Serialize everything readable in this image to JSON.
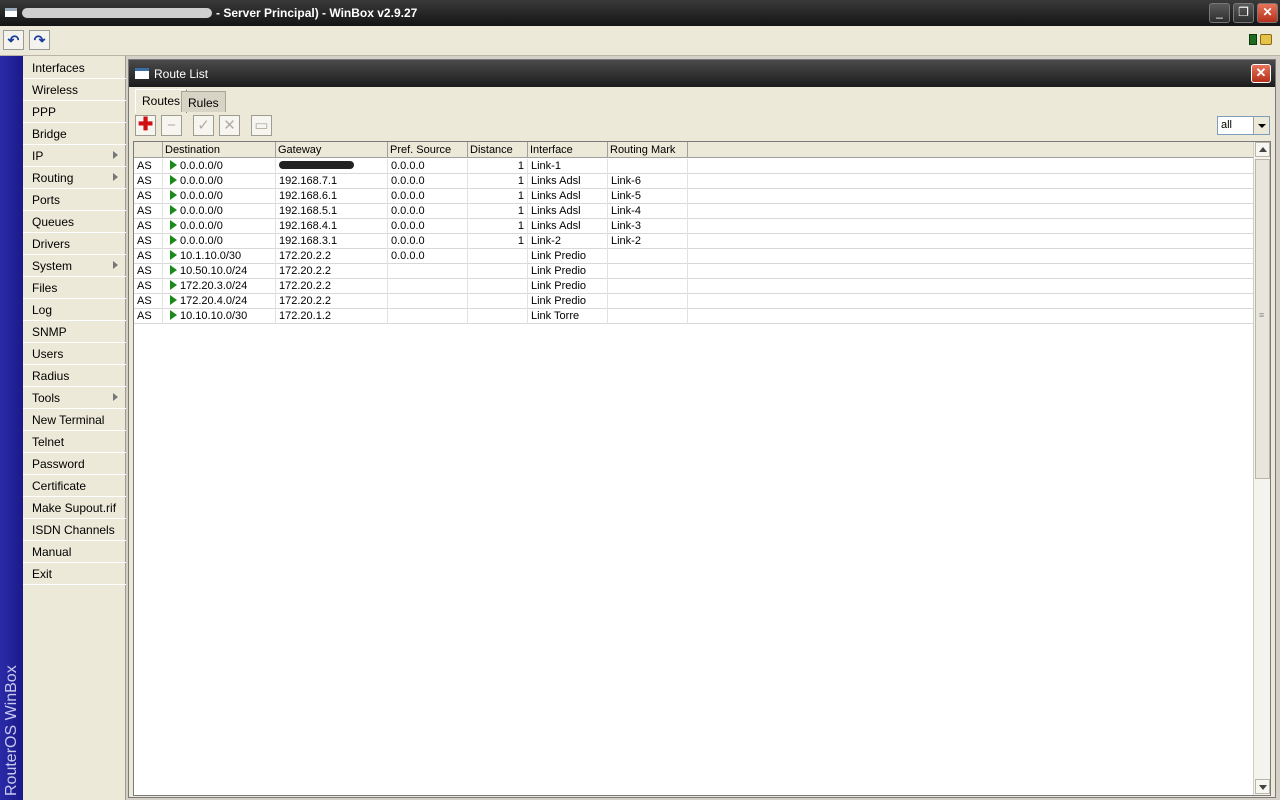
{
  "window": {
    "title": "- Server Principal) - WinBox v2.9.27",
    "minimize": "_",
    "restore": "❐",
    "close": "✕"
  },
  "toolbar": {
    "undo": "↶",
    "redo": "↷"
  },
  "brand": "RouterOS WinBox",
  "menu": [
    {
      "label": "Interfaces"
    },
    {
      "label": "Wireless"
    },
    {
      "label": "PPP"
    },
    {
      "label": "Bridge"
    },
    {
      "label": "IP",
      "submenu": true
    },
    {
      "label": "Routing",
      "submenu": true
    },
    {
      "label": "Ports"
    },
    {
      "label": "Queues"
    },
    {
      "label": "Drivers"
    },
    {
      "label": "System",
      "submenu": true
    },
    {
      "label": "Files"
    },
    {
      "label": "Log"
    },
    {
      "label": "SNMP"
    },
    {
      "label": "Users"
    },
    {
      "label": "Radius"
    },
    {
      "label": "Tools",
      "submenu": true
    },
    {
      "label": "New Terminal"
    },
    {
      "label": "Telnet"
    },
    {
      "label": "Password"
    },
    {
      "label": "Certificate"
    },
    {
      "label": "Make Supout.rif"
    },
    {
      "label": "ISDN Channels"
    },
    {
      "label": "Manual"
    },
    {
      "label": "Exit"
    }
  ],
  "route_window": {
    "title": "Route List",
    "close": "✕",
    "tabs": [
      {
        "label": "Routes",
        "active": true
      },
      {
        "label": "Rules",
        "active": false
      }
    ],
    "actions": {
      "add": "✚",
      "remove": "−",
      "enable": "✓",
      "disable": "✕",
      "comment": "▭"
    },
    "filter": "all",
    "columns": [
      "",
      "Destination",
      "Gateway",
      "Pref. Source",
      "Distance",
      "Interface",
      "Routing Mark"
    ],
    "rows": [
      {
        "flags": "AS",
        "destination": "0.0.0.0/0",
        "gateway": "",
        "gateway_redacted": true,
        "pref_source": "0.0.0.0",
        "distance": "1",
        "interface": "Link-1",
        "routing_mark": ""
      },
      {
        "flags": "AS",
        "destination": "0.0.0.0/0",
        "gateway": "192.168.7.1",
        "pref_source": "0.0.0.0",
        "distance": "1",
        "interface": "Links Adsl",
        "routing_mark": "Link-6"
      },
      {
        "flags": "AS",
        "destination": "0.0.0.0/0",
        "gateway": "192.168.6.1",
        "pref_source": "0.0.0.0",
        "distance": "1",
        "interface": "Links Adsl",
        "routing_mark": "Link-5"
      },
      {
        "flags": "AS",
        "destination": "0.0.0.0/0",
        "gateway": "192.168.5.1",
        "pref_source": "0.0.0.0",
        "distance": "1",
        "interface": "Links Adsl",
        "routing_mark": "Link-4"
      },
      {
        "flags": "AS",
        "destination": "0.0.0.0/0",
        "gateway": "192.168.4.1",
        "pref_source": "0.0.0.0",
        "distance": "1",
        "interface": "Links Adsl",
        "routing_mark": "Link-3"
      },
      {
        "flags": "AS",
        "destination": "0.0.0.0/0",
        "gateway": "192.168.3.1",
        "pref_source": "0.0.0.0",
        "distance": "1",
        "interface": "Link-2",
        "routing_mark": "Link-2"
      },
      {
        "flags": "AS",
        "destination": "10.1.10.0/30",
        "gateway": "172.20.2.2",
        "pref_source": "0.0.0.0",
        "distance": "",
        "interface": "Link Predio",
        "routing_mark": ""
      },
      {
        "flags": "AS",
        "destination": "10.50.10.0/24",
        "gateway": "172.20.2.2",
        "pref_source": "",
        "distance": "",
        "interface": "Link Predio",
        "routing_mark": ""
      },
      {
        "flags": "AS",
        "destination": "172.20.3.0/24",
        "gateway": "172.20.2.2",
        "pref_source": "",
        "distance": "",
        "interface": "Link Predio",
        "routing_mark": ""
      },
      {
        "flags": "AS",
        "destination": "172.20.4.0/24",
        "gateway": "172.20.2.2",
        "pref_source": "",
        "distance": "",
        "interface": "Link Predio",
        "routing_mark": ""
      },
      {
        "flags": "AS",
        "destination": "10.10.10.0/30",
        "gateway": "172.20.1.2",
        "pref_source": "",
        "distance": "",
        "interface": "Link Torre",
        "routing_mark": ""
      }
    ]
  }
}
